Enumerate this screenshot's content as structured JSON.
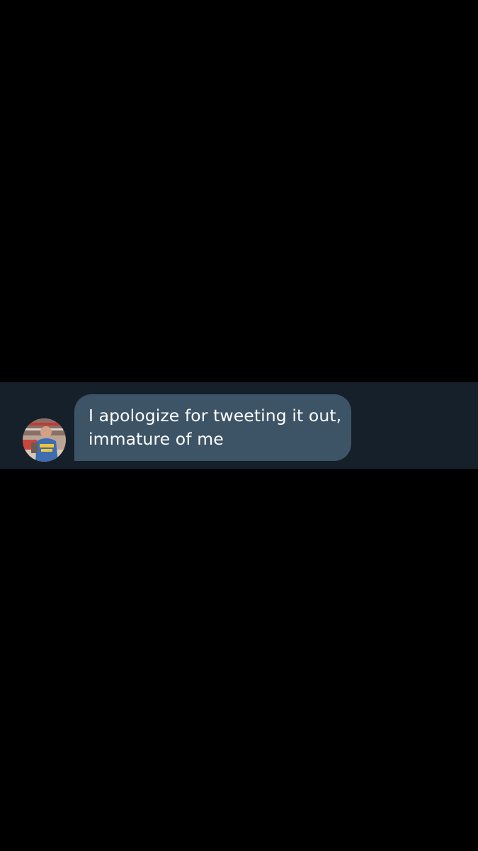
{
  "conversation": {
    "message": {
      "lines": [
        "I apologize for tweeting it out,",
        "immature of me"
      ],
      "bubble_color": "#3d5466",
      "text_color": "#ffffff"
    },
    "sender": {
      "avatar_icon": "user-photo-avatar"
    },
    "background_color": "#15202b"
  }
}
